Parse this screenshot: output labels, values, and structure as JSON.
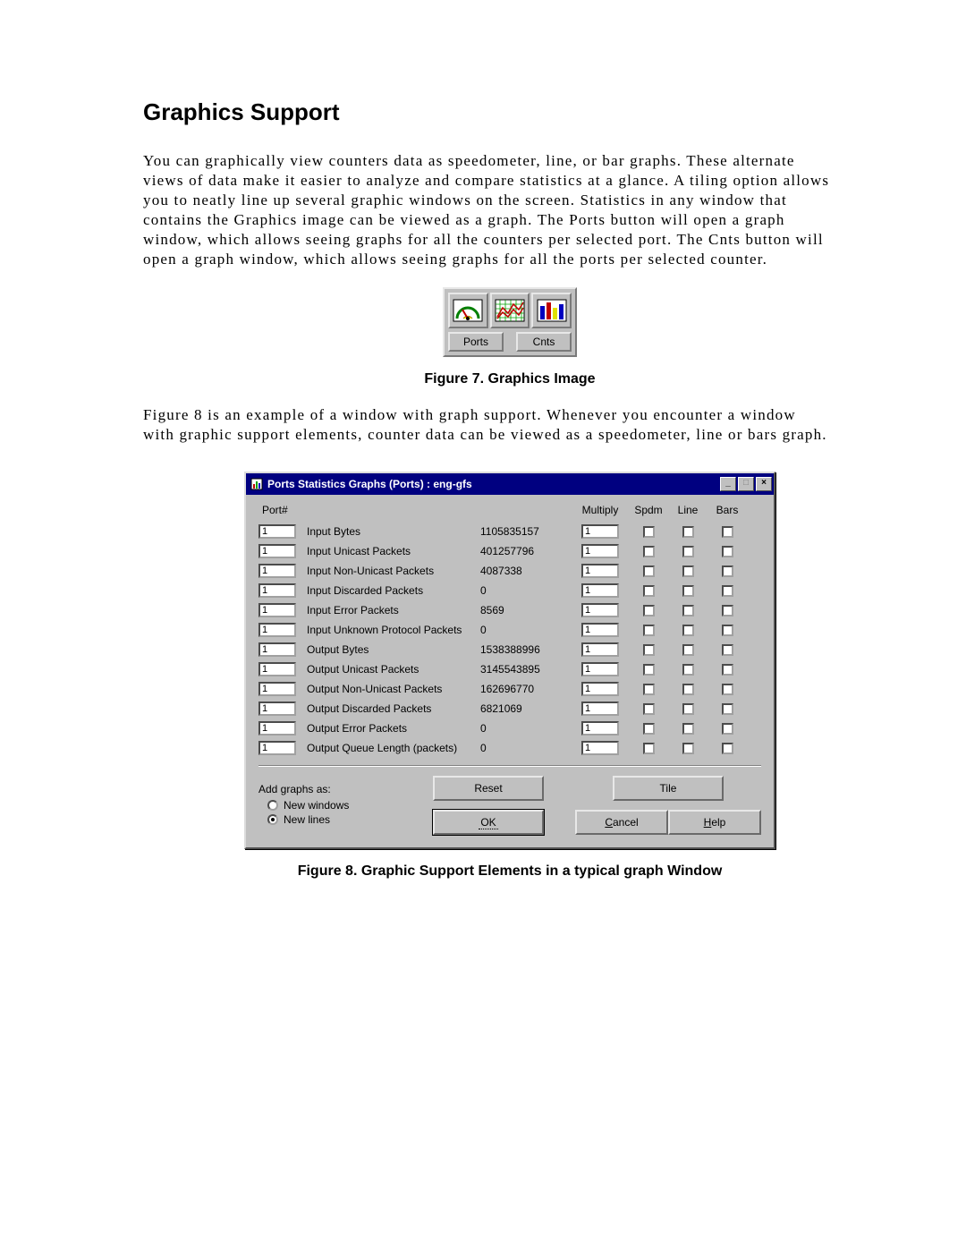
{
  "section": {
    "title": "Graphics Support"
  },
  "para1": "You can graphically view counters data as speedometer, line, or bar graphs. These alternate views of data make it easier to analyze and compare statistics at a glance. A tiling option allows you to neatly line up several graphic windows on the screen. Statistics in any window that contains the Graphics image can be viewed as a graph. The Ports button will open a graph window, which allows seeing graphs for all the counters per selected port. The Cnts button will open a graph window, which allows seeing graphs for all the ports per selected counter.",
  "para2": "Figure 8 is an example of a window with graph support. Whenever you encounter a window with graphic support elements, counter data can be viewed as a speedometer, line or bars graph.",
  "fig7": {
    "caption": "Figure 7. Graphics Image",
    "buttons": {
      "ports": "Ports",
      "cnts": "Cnts"
    }
  },
  "fig8": {
    "caption": "Figure 8. Graphic Support Elements in a typical graph Window",
    "window_title": "Ports Statistics Graphs (Ports) : eng-gfs",
    "headers": {
      "port": "Port#",
      "multiply": "Multiply",
      "spdm": "Spdm",
      "line": "Line",
      "bars": "Bars"
    },
    "rows": [
      {
        "port": "1",
        "name": "Input Bytes",
        "value": "1105835157",
        "mult": "1"
      },
      {
        "port": "1",
        "name": "Input Unicast Packets",
        "value": "401257796",
        "mult": "1"
      },
      {
        "port": "1",
        "name": "Input Non-Unicast Packets",
        "value": "4087338",
        "mult": "1"
      },
      {
        "port": "1",
        "name": "Input Discarded Packets",
        "value": "0",
        "mult": "1"
      },
      {
        "port": "1",
        "name": "Input Error Packets",
        "value": "8569",
        "mult": "1"
      },
      {
        "port": "1",
        "name": "Input Unknown Protocol Packets",
        "value": "0",
        "mult": "1"
      },
      {
        "port": "1",
        "name": "Output Bytes",
        "value": "1538388996",
        "mult": "1"
      },
      {
        "port": "1",
        "name": "Output Unicast Packets",
        "value": "3145543895",
        "mult": "1"
      },
      {
        "port": "1",
        "name": "Output Non-Unicast Packets",
        "value": "162696770",
        "mult": "1"
      },
      {
        "port": "1",
        "name": "Output Discarded Packets",
        "value": "6821069",
        "mult": "1"
      },
      {
        "port": "1",
        "name": "Output Error Packets",
        "value": "0",
        "mult": "1"
      },
      {
        "port": "1",
        "name": "Output Queue Length (packets)",
        "value": "0",
        "mult": "1"
      }
    ],
    "addgraphs": {
      "label": "Add graphs as:",
      "opt1": "New windows",
      "opt2": "New lines",
      "selected": "opt2"
    },
    "buttons": {
      "reset": "Reset",
      "tile": "Tile",
      "ok": "OK",
      "cancel": "Cancel",
      "help": "Help"
    }
  }
}
